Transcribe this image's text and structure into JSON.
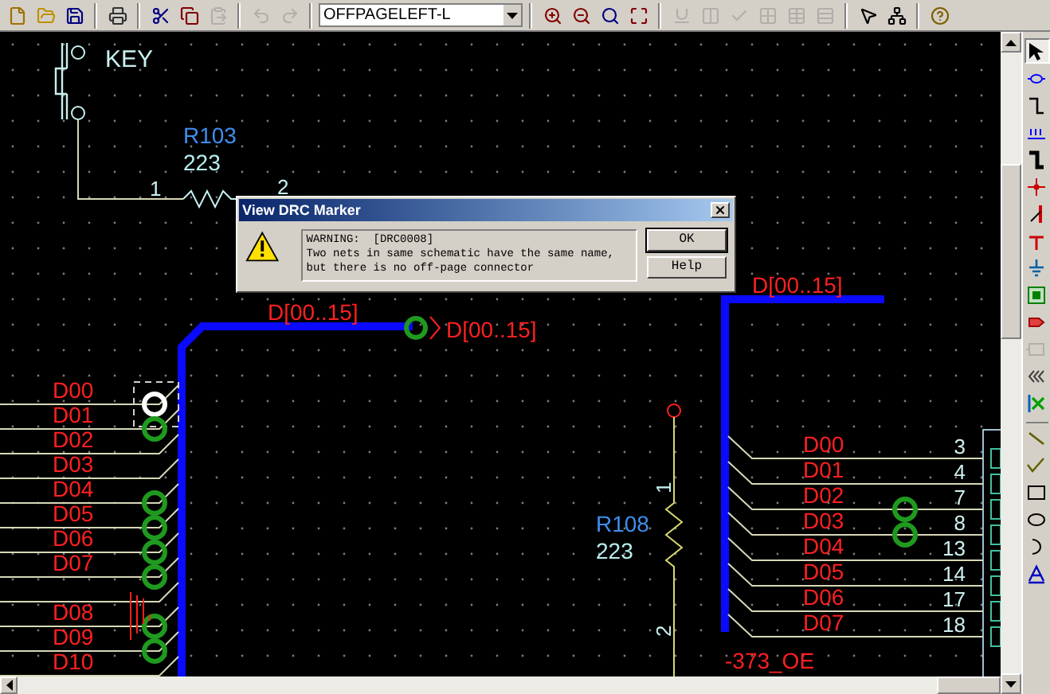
{
  "toolbar": {
    "items": [
      {
        "kind": "new",
        "disabled": false
      },
      {
        "kind": "open",
        "disabled": false
      },
      {
        "kind": "save",
        "disabled": false
      },
      {
        "kind": "separator"
      },
      {
        "kind": "print",
        "disabled": false
      },
      {
        "kind": "separator"
      },
      {
        "kind": "cut",
        "disabled": false
      },
      {
        "kind": "copy",
        "disabled": false
      },
      {
        "kind": "paste",
        "disabled": true
      },
      {
        "kind": "separator"
      },
      {
        "kind": "undo",
        "disabled": true
      },
      {
        "kind": "redo",
        "disabled": true
      },
      {
        "kind": "separator"
      },
      {
        "kind": "dropdown",
        "value": "OFFPAGELEFT-L"
      },
      {
        "kind": "separator"
      },
      {
        "kind": "zoom-in",
        "disabled": false
      },
      {
        "kind": "zoom-out",
        "disabled": false
      },
      {
        "kind": "zoom-area",
        "disabled": false
      },
      {
        "kind": "zoom-all",
        "disabled": false
      },
      {
        "kind": "separator"
      },
      {
        "kind": "annotate",
        "disabled": true
      },
      {
        "kind": "back-annotate",
        "disabled": true
      },
      {
        "kind": "drc",
        "disabled": true
      },
      {
        "kind": "netlist",
        "disabled": true
      },
      {
        "kind": "cross-reference",
        "disabled": true
      },
      {
        "kind": "bill",
        "disabled": true
      },
      {
        "kind": "separator"
      },
      {
        "kind": "pointer",
        "disabled": false
      },
      {
        "kind": "hierarchy",
        "disabled": false
      },
      {
        "kind": "separator"
      },
      {
        "kind": "help",
        "disabled": false
      }
    ]
  },
  "schematic": {
    "key_switch": {
      "name": "KEY"
    },
    "resistors": [
      {
        "ref": "R103",
        "value": "223",
        "pin_1": "1",
        "pin_2": "2"
      },
      {
        "ref": "R108",
        "value": "223",
        "pin_1": "1",
        "pin_2": "2"
      }
    ],
    "bus_labels": [
      "D[00..15]",
      "D[00..15]"
    ],
    "offpage_connector": {
      "label": "D[00..15]"
    },
    "left_nets": [
      {
        "label": "D00",
        "drc_marker": true,
        "selected": true
      },
      {
        "label": "D01",
        "drc_marker": true,
        "selected": false
      },
      {
        "label": "D02",
        "drc_marker": false,
        "selected": false
      },
      {
        "label": "D03",
        "drc_marker": false,
        "selected": false
      },
      {
        "label": "D04",
        "drc_marker": true,
        "selected": false
      },
      {
        "label": "D05",
        "drc_marker": true,
        "selected": false
      },
      {
        "label": "D06",
        "drc_marker": true,
        "selected": false
      },
      {
        "label": "D07",
        "drc_marker": true,
        "selected": false
      },
      {
        "drc_marker": false,
        "selected": false
      },
      {
        "label": "D08",
        "drc_marker": true,
        "selected": false
      },
      {
        "label": "D09",
        "drc_marker": true,
        "selected": false
      },
      {
        "label": "D10",
        "drc_marker": false,
        "selected": false
      }
    ],
    "right_nets": [
      {
        "label": "D00",
        "pin": "3",
        "drc_marker": false
      },
      {
        "label": "D01",
        "pin": "4",
        "drc_marker": false
      },
      {
        "label": "D02",
        "pin": "7",
        "drc_marker": true
      },
      {
        "label": "D03",
        "pin": "8",
        "drc_marker": true
      },
      {
        "label": "D04",
        "pin": "13",
        "drc_marker": false
      },
      {
        "label": "D05",
        "pin": "14",
        "drc_marker": false
      },
      {
        "label": "D06",
        "pin": "17",
        "drc_marker": false
      },
      {
        "label": "D07",
        "pin": "18",
        "drc_marker": false
      }
    ],
    "bottom_label": "-373_OE"
  },
  "dialog": {
    "title": "View DRC Marker",
    "code": "WARNING:  [DRC0008]",
    "message": "Two nets in same schematic have the same name, but there is no off-page connector",
    "buttons": [
      {
        "label": "OK",
        "default": true
      },
      {
        "label": "Help",
        "default": false
      }
    ]
  },
  "palette": {
    "tools": [
      {
        "kind": "select",
        "selected": true,
        "disabled": false
      },
      {
        "kind": "part",
        "selected": false,
        "disabled": false
      },
      {
        "kind": "wire",
        "selected": false,
        "disabled": false
      },
      {
        "kind": "net-alias",
        "selected": false,
        "disabled": false
      },
      {
        "kind": "bus",
        "selected": false,
        "disabled": false
      },
      {
        "kind": "junction",
        "selected": false,
        "disabled": false
      },
      {
        "kind": "bus-entry",
        "selected": false,
        "disabled": false
      },
      {
        "kind": "power",
        "selected": false,
        "disabled": false
      },
      {
        "kind": "ground",
        "selected": false,
        "disabled": false
      },
      {
        "kind": "block",
        "selected": false,
        "disabled": false
      },
      {
        "kind": "port",
        "selected": false,
        "disabled": false
      },
      {
        "kind": "pin",
        "selected": false,
        "disabled": true
      },
      {
        "kind": "offpage",
        "selected": false,
        "disabled": false
      },
      {
        "kind": "no-connect",
        "selected": false,
        "disabled": false
      },
      {
        "kind": "separator"
      },
      {
        "kind": "line",
        "selected": false,
        "disabled": false
      },
      {
        "kind": "polyline",
        "selected": false,
        "disabled": false
      },
      {
        "kind": "rectangle",
        "selected": false,
        "disabled": false
      },
      {
        "kind": "ellipse",
        "selected": false,
        "disabled": false
      },
      {
        "kind": "arc",
        "selected": false,
        "disabled": false
      },
      {
        "kind": "text",
        "selected": false,
        "disabled": false
      }
    ]
  }
}
